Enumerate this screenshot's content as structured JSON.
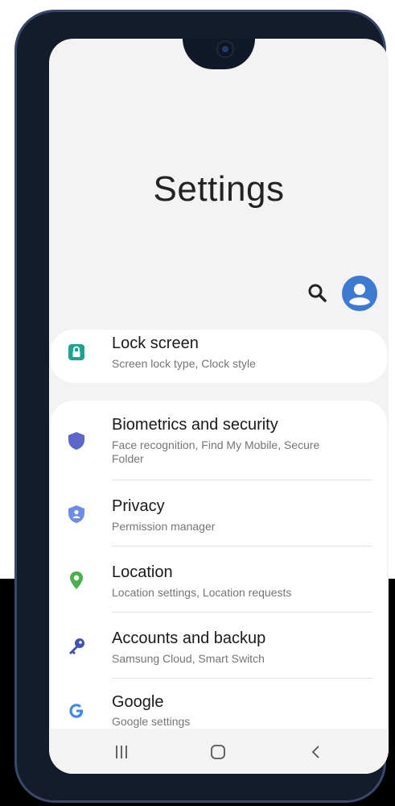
{
  "screen": {
    "title": "Settings"
  },
  "toolbar": {
    "search_icon": "search-icon",
    "profile_icon": "account-avatar-icon"
  },
  "items": [
    {
      "title": "Lock screen",
      "subtitle": "Screen lock type, Clock style",
      "icon": "lock-icon",
      "color": "#1aa58c"
    },
    {
      "title": "Biometrics and security",
      "subtitle": "Face recognition, Find My Mobile, Secure Folder",
      "icon": "shield-icon",
      "color": "#5c67c9"
    },
    {
      "title": "Privacy",
      "subtitle": "Permission manager",
      "icon": "privacy-shield-icon",
      "color": "#6d8ce8"
    },
    {
      "title": "Location",
      "subtitle": "Location settings, Location requests",
      "icon": "location-pin-icon",
      "color": "#4caf50"
    },
    {
      "title": "Accounts and backup",
      "subtitle": "Samsung Cloud, Smart Switch",
      "icon": "key-icon",
      "color": "#3f51b5"
    },
    {
      "title": "Google",
      "subtitle": "Google settings",
      "icon": "google-icon",
      "color": "#4285f4"
    }
  ],
  "navbar": {
    "recents_icon": "recents-icon",
    "home_icon": "home-icon",
    "back_icon": "back-icon"
  },
  "colors": {
    "background": "#f3f3f3",
    "card": "#ffffff",
    "accent": "#3d7bd2"
  }
}
